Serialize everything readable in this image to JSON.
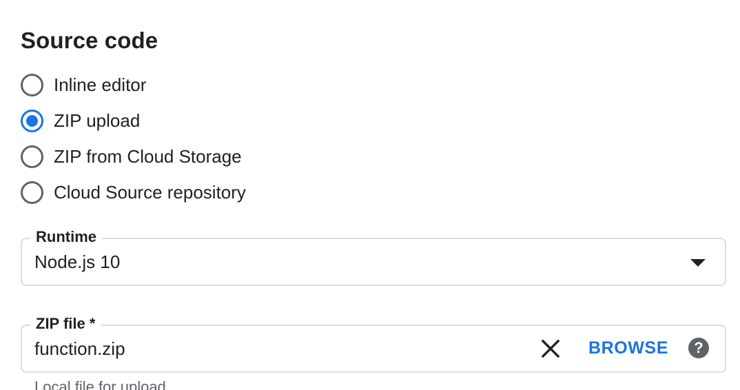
{
  "source_code": {
    "title": "Source code",
    "options": [
      {
        "label": "Inline editor",
        "selected": false
      },
      {
        "label": "ZIP upload",
        "selected": true
      },
      {
        "label": "ZIP from Cloud Storage",
        "selected": false
      },
      {
        "label": "Cloud Source repository",
        "selected": false
      }
    ]
  },
  "runtime": {
    "label": "Runtime",
    "value": "Node.js 10",
    "icon": "dropdown-arrow-icon"
  },
  "zip_file": {
    "label": "ZIP file *",
    "value": "function.zip",
    "clear_icon": "close-icon",
    "browse_label": "BROWSE",
    "help_icon": "help-icon",
    "help_glyph": "?",
    "hint": "Local file for upload"
  },
  "colors": {
    "accent": "#1a73e8",
    "text": "#202124",
    "muted": "#5f6368",
    "border": "#dadce0"
  }
}
